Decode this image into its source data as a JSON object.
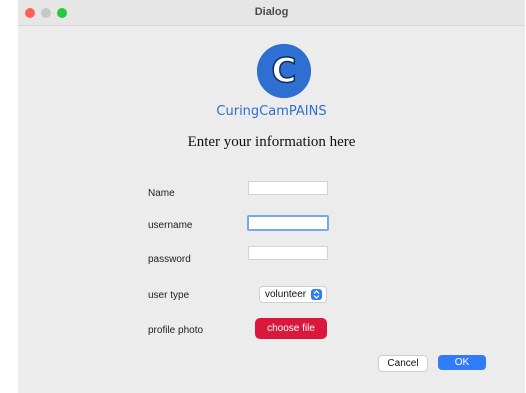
{
  "window": {
    "title": "Dialog"
  },
  "logo": {
    "letter": "C",
    "text": "CuringCamPAINS"
  },
  "heading": "Enter your information here",
  "form": {
    "name_label": "Name",
    "username_label": "username",
    "password_label": "password",
    "user_type_label": "user type",
    "user_type_value": "volunteer",
    "profile_photo_label": "profile photo",
    "choose_file_label": "choose file"
  },
  "buttons": {
    "cancel": "Cancel",
    "ok": "OK"
  },
  "colors": {
    "accent": "#2f7cf6",
    "file_button": "#d9183b",
    "logo": "#2e6fd1"
  }
}
